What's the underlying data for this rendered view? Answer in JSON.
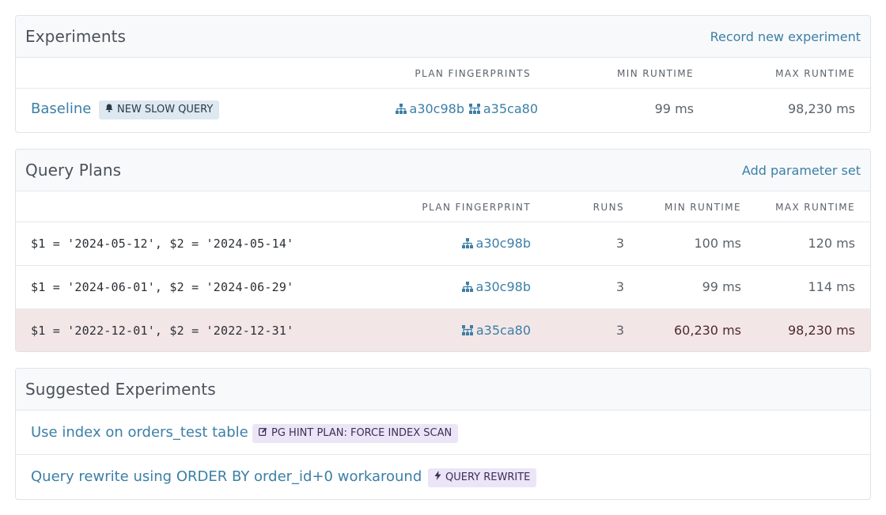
{
  "experiments": {
    "title": "Experiments",
    "action": "Record new experiment",
    "columns": {
      "fingerprints": "PLAN FINGERPRINTS",
      "min": "MIN RUNTIME",
      "max": "MAX RUNTIME"
    },
    "rows": [
      {
        "name": "Baseline",
        "badge": "NEW SLOW QUERY",
        "badge_icon": "bell-icon",
        "fingerprints": [
          {
            "id": "a30c98b",
            "icon": "sitemap-icon"
          },
          {
            "id": "a35ca80",
            "icon": "network-tree-icon"
          }
        ],
        "min": "99 ms",
        "max": "98,230 ms"
      }
    ]
  },
  "query_plans": {
    "title": "Query Plans",
    "action": "Add parameter set",
    "columns": {
      "fingerprint": "PLAN FINGERPRINT",
      "runs": "RUNS",
      "min": "MIN RUNTIME",
      "max": "MAX RUNTIME"
    },
    "rows": [
      {
        "params": "$1 = '2024-05-12', $2 = '2024-05-14'",
        "fingerprint": "a30c98b",
        "icon": "sitemap-icon",
        "runs": "3",
        "min": "100 ms",
        "max": "120 ms",
        "highlight": false
      },
      {
        "params": "$1 = '2024-06-01', $2 = '2024-06-29'",
        "fingerprint": "a30c98b",
        "icon": "sitemap-icon",
        "runs": "3",
        "min": "99 ms",
        "max": "114 ms",
        "highlight": false
      },
      {
        "params": "$1 = '2022-12-01', $2 = '2022-12-31'",
        "fingerprint": "a35ca80",
        "icon": "network-tree-icon",
        "runs": "3",
        "min": "60,230 ms",
        "max": "98,230 ms",
        "highlight": true
      }
    ]
  },
  "suggested": {
    "title": "Suggested Experiments",
    "items": [
      {
        "label": "Use index on orders_test table",
        "badge": "PG HINT PLAN: FORCE INDEX SCAN",
        "badge_icon": "edit-icon"
      },
      {
        "label": "Query rewrite using ORDER BY order_id+0 workaround",
        "badge": "QUERY REWRITE",
        "badge_icon": "bolt-icon"
      }
    ]
  },
  "colors": {
    "link": "#3b7fa6",
    "slow_row_bg": "#f3e6e7",
    "badge_blue_bg": "#dde8f1",
    "badge_purple_bg": "#ebe5f7"
  }
}
